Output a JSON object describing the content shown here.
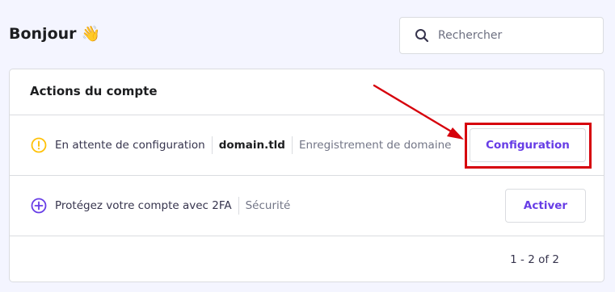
{
  "header": {
    "greeting": "Bonjour",
    "greeting_emoji": "👋"
  },
  "search": {
    "placeholder": "Rechercher",
    "icon": "search-icon"
  },
  "card": {
    "title": "Actions du compte",
    "rows": [
      {
        "icon": "warning-circle-icon",
        "icon_color": "#ffc107",
        "text": "En attente de configuration",
        "domain": "domain.tld",
        "category": "Enregistrement de domaine",
        "button": "Configuration"
      },
      {
        "icon": "plus-circle-icon",
        "icon_color": "#673de6",
        "text": "Protégez votre compte avec 2FA",
        "category": "Sécurité",
        "button": "Activer"
      }
    ],
    "pagination": "1 - 2 of 2"
  },
  "annotation": {
    "color": "#d6000b"
  }
}
